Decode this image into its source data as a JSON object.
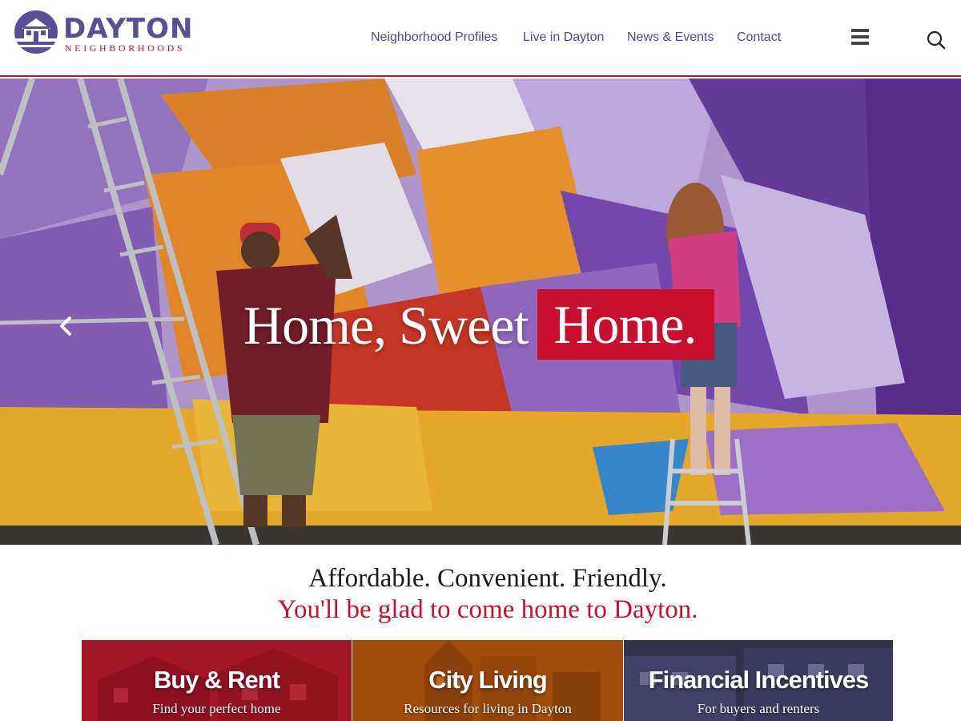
{
  "brand": {
    "name": "DAYTON",
    "subtitle": "NEIGHBORHOODS",
    "primary_color": "#5a4e96",
    "accent_color": "#c8102e"
  },
  "nav": {
    "items": [
      {
        "label": "Neighborhood Profiles"
      },
      {
        "label": "Live in Dayton"
      },
      {
        "label": "News & Events"
      },
      {
        "label": "Contact"
      }
    ],
    "menu_icon": "hamburger-icon",
    "search_icon": "search-icon"
  },
  "hero": {
    "title_part1": "Home, Sweet",
    "title_part2": "Home.",
    "prev_icon": "chevron-left-icon",
    "image_subject": "mural-painters"
  },
  "tagline": {
    "line1": "Affordable. Convenient. Friendly.",
    "line2": "You'll be glad to come home to Dayton."
  },
  "cards": [
    {
      "title": "Buy & Rent",
      "subtitle": "Find your perfect home",
      "tint": "#b3202a"
    },
    {
      "title": "City Living",
      "subtitle": "Resources for living in Dayton",
      "tint": "#b5500a"
    },
    {
      "title": "Financial Incentives",
      "subtitle": "For buyers and renters",
      "tint": "#3e3c66"
    }
  ]
}
